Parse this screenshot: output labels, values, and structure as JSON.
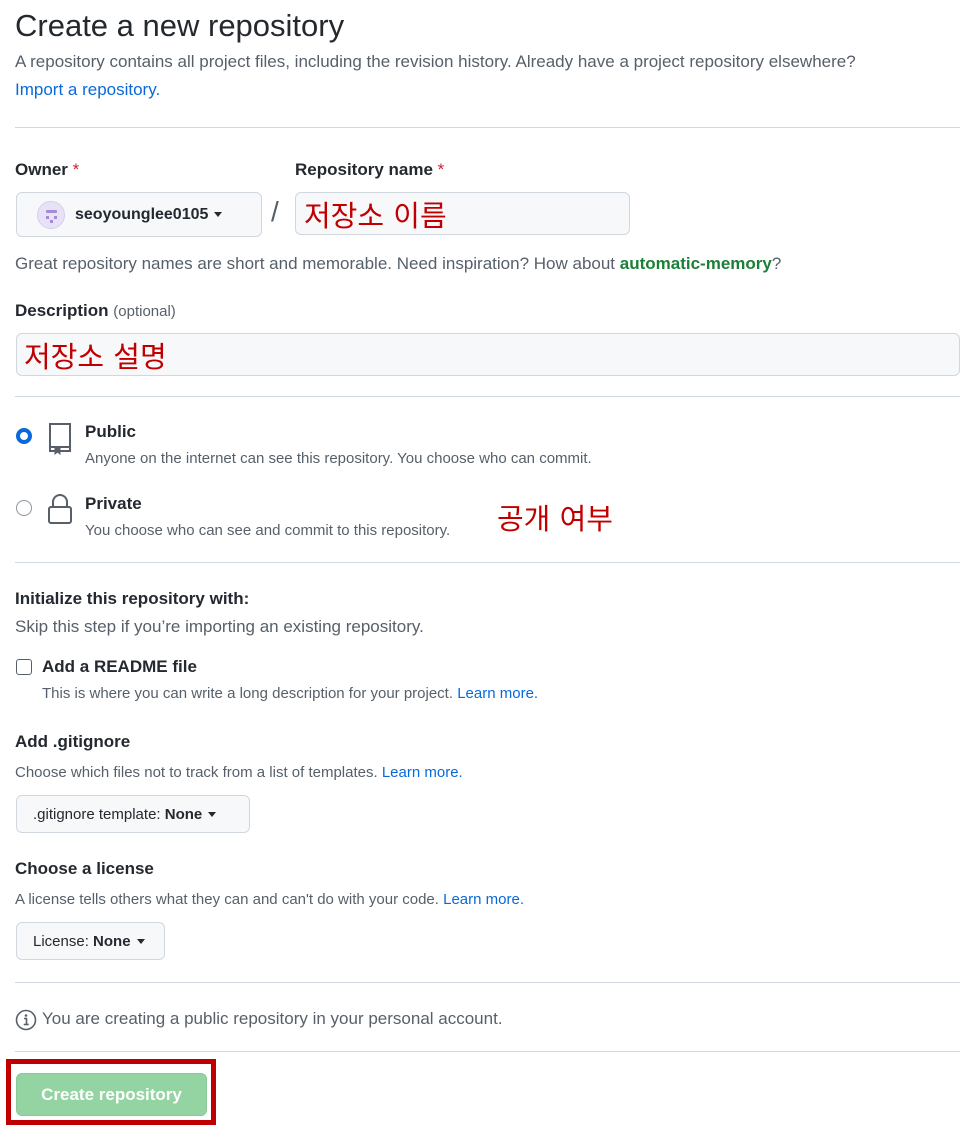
{
  "header": {
    "title": "Create a new repository",
    "subtitle": "A repository contains all project files, including the revision history. Already have a project repository elsewhere?",
    "import_link": "Import a repository."
  },
  "owner": {
    "label": "Owner",
    "required_mark": "*",
    "value": "seoyounglee0105"
  },
  "separator": "/",
  "repo_name": {
    "label": "Repository name",
    "required_mark": "*",
    "annotation": "저장소 이름"
  },
  "name_hint": {
    "prefix": "Great repository names are short and memorable. Need inspiration? How about ",
    "suggestion": "automatic-memory",
    "suffix": "?"
  },
  "description": {
    "label": "Description",
    "optional": "(optional)",
    "annotation": "저장소 설명"
  },
  "visibility": {
    "annotation": "공개 여부",
    "public": {
      "label": "Public",
      "desc": "Anyone on the internet can see this repository. You choose who can commit.",
      "selected": true
    },
    "private": {
      "label": "Private",
      "desc": "You choose who can see and commit to this repository.",
      "selected": false
    }
  },
  "initialize": {
    "heading": "Initialize this repository with:",
    "skip_text": "Skip this step if you’re importing an existing repository.",
    "readme": {
      "label": "Add a README file",
      "desc": "This is where you can write a long description for your project.",
      "learn_more": "Learn more.",
      "checked": false
    }
  },
  "gitignore": {
    "heading": "Add .gitignore",
    "desc": "Choose which files not to track from a list of templates.",
    "learn_more": "Learn more.",
    "button_prefix": ".gitignore template: ",
    "button_value": "None"
  },
  "license": {
    "heading": "Choose a license",
    "desc": "A license tells others what they can and can't do with your code.",
    "learn_more": "Learn more.",
    "button_prefix": "License: ",
    "button_value": "None"
  },
  "notice": "You are creating a public repository in your personal account.",
  "submit": {
    "label": "Create repository"
  },
  "colors": {
    "accent": "#0969da",
    "annotation_red": "#c00000",
    "submit_green": "#94d3a2",
    "highlight_box": "#c00000"
  }
}
